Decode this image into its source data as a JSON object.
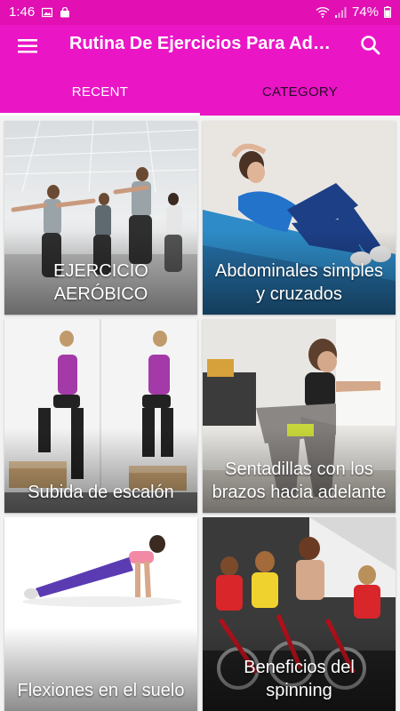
{
  "status_bar": {
    "time": "1:46",
    "battery_text": "74%",
    "icons": [
      "image-icon",
      "shopping-bag-icon",
      "wifi-icon",
      "signal-icon",
      "battery-icon"
    ]
  },
  "app_bar": {
    "title": "Rutina De Ejercicios Para Adultos Mayores",
    "menu_icon": "menu-icon",
    "search_icon": "search-icon"
  },
  "tabs": [
    {
      "label": "RECENT",
      "active": true
    },
    {
      "label": "CATEGORY",
      "active": false
    }
  ],
  "cards": [
    {
      "label": "EJERCICIO AERÓBICO"
    },
    {
      "label": "Abdominales simples y cruzados"
    },
    {
      "label": "Subida de escalón"
    },
    {
      "label": "Sentadillas con los brazos hacia adelante"
    },
    {
      "label": "Flexiones en el suelo"
    },
    {
      "label": "Beneficios del spinning"
    }
  ],
  "colors": {
    "status_bar": "#e20fb3",
    "app_bar": "#ea16c6",
    "background": "#f2f2f2"
  }
}
